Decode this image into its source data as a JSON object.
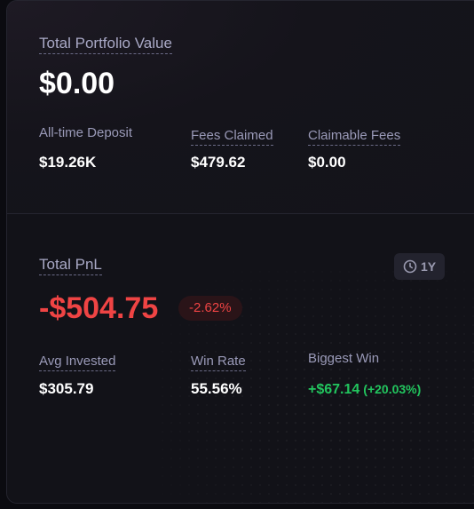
{
  "portfolio": {
    "title": "Total Portfolio Value",
    "value": "$0.00",
    "stats": [
      {
        "label": "All-time Deposit",
        "value": "$19.26K"
      },
      {
        "label": "Fees Claimed",
        "value": "$479.62"
      },
      {
        "label": "Claimable Fees",
        "value": "$0.00"
      }
    ]
  },
  "pnl": {
    "title": "Total PnL",
    "value": "-$504.75",
    "change_pct": "-2.62%",
    "period": "1Y",
    "period_icon": "clock-icon",
    "stats": [
      {
        "label": "Avg Invested",
        "value": "$305.79"
      },
      {
        "label": "Win Rate",
        "value": "55.56%"
      },
      {
        "label": "Biggest Win",
        "value": "+$67.14",
        "pct": "(+20.03%)"
      }
    ]
  },
  "colors": {
    "negative": "#ef4444",
    "positive": "#22c55e",
    "background": "#13131a"
  }
}
